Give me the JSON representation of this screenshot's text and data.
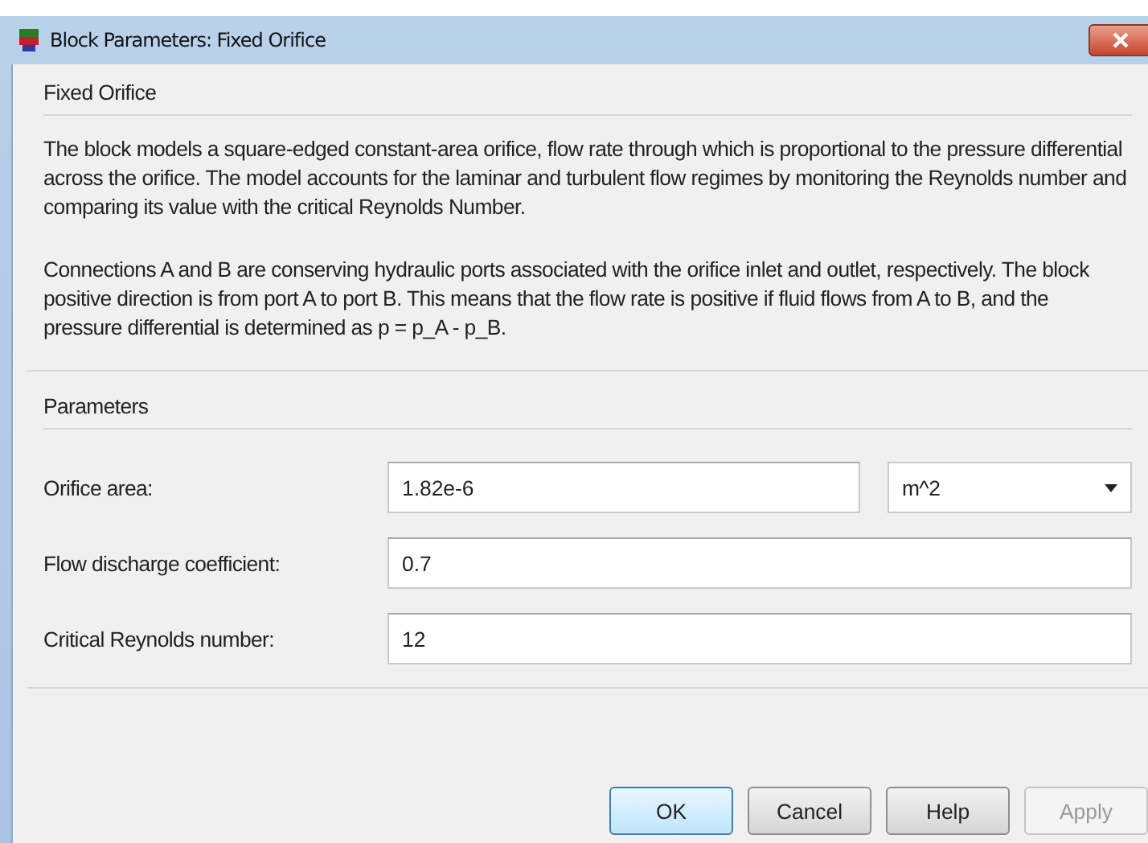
{
  "window": {
    "title": "Block Parameters: Fixed Orifice"
  },
  "description": {
    "heading": "Fixed Orifice",
    "paragraphs": [
      "The block models a square-edged constant-area orifice, flow rate through which is proportional to the pressure differential across the orifice. The model accounts for the laminar and turbulent flow regimes by monitoring the Reynolds number and comparing its value with the critical Reynolds Number.",
      "Connections A and B are conserving hydraulic ports associated with the orifice inlet and outlet, respectively. The block positive direction is from port A to port B. This means that the flow rate is positive if fluid flows from A to B, and the pressure differential is determined as p = p_A - p_B."
    ]
  },
  "parameters": {
    "heading": "Parameters",
    "rows": [
      {
        "label": "Orifice area:",
        "value": "1.82e-6",
        "unit": "m^2"
      },
      {
        "label": "Flow discharge coefficient:",
        "value": "0.7"
      },
      {
        "label": "Critical Reynolds number:",
        "value": "12"
      }
    ]
  },
  "buttons": [
    {
      "label": "OK",
      "default": true,
      "disabled": false
    },
    {
      "label": "Cancel",
      "default": false,
      "disabled": false
    },
    {
      "label": "Help",
      "default": false,
      "disabled": false
    },
    {
      "label": "Apply",
      "default": false,
      "disabled": true
    }
  ]
}
